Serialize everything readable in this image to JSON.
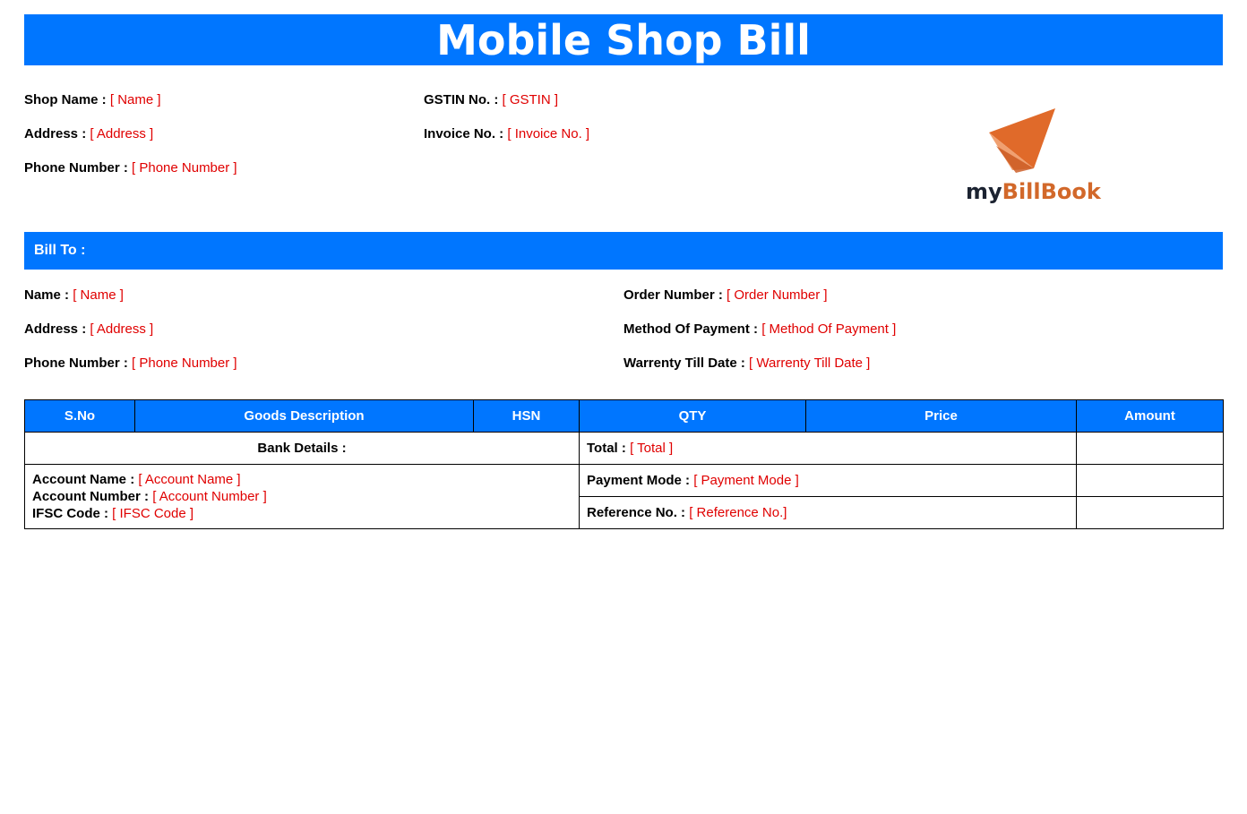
{
  "title": "Mobile Shop Bill",
  "shop": {
    "name_label": "Shop Name :",
    "name_value": "[ Name ]",
    "address_label": "Address :",
    "address_value": "[ Address ]",
    "phone_label": "Phone Number :",
    "phone_value": "[ Phone Number ]",
    "gstin_label": "GSTIN No. :",
    "gstin_value": "[ GSTIN ]",
    "invoice_label": "Invoice No. :",
    "invoice_value": "[ Invoice No. ]"
  },
  "logo": {
    "text_my": "my",
    "text_billbook": "BillBook",
    "brand_color": "#d2682a"
  },
  "bill_to": {
    "heading": "Bill To :",
    "name_label": "Name :",
    "name_value": "[ Name ]",
    "address_label": "Address :",
    "address_value": "[ Address ]",
    "phone_label": "Phone Number :",
    "phone_value": "[ Phone Number ]",
    "order_label": "Order Number :",
    "order_value": "[ Order Number ]",
    "payment_method_label": "Method Of Payment :",
    "payment_method_value": "[ Method Of Payment ]",
    "warranty_label": "Warrenty Till Date :",
    "warranty_value": "[ Warrenty Till Date ]"
  },
  "table": {
    "headers": [
      "S.No",
      "Goods Description",
      "HSN",
      "QTY",
      "Price",
      "Amount"
    ],
    "bank_details_label": "Bank Details :",
    "total_label": "Total :",
    "total_value": "[ Total ]",
    "account_name_label": "Account Name :",
    "account_name_value": "[ Account Name ]",
    "account_number_label": "Account Number :",
    "account_number_value": "[ Account Number ]",
    "ifsc_label": "IFSC Code :",
    "ifsc_value": "[ IFSC Code ]",
    "payment_mode_label": "Payment Mode :",
    "payment_mode_value": "[ Payment Mode ]",
    "reference_label": "Reference No. :",
    "reference_value": "[ Reference No.]"
  },
  "colors": {
    "accent": "#0076ff",
    "placeholder": "#e00000"
  }
}
